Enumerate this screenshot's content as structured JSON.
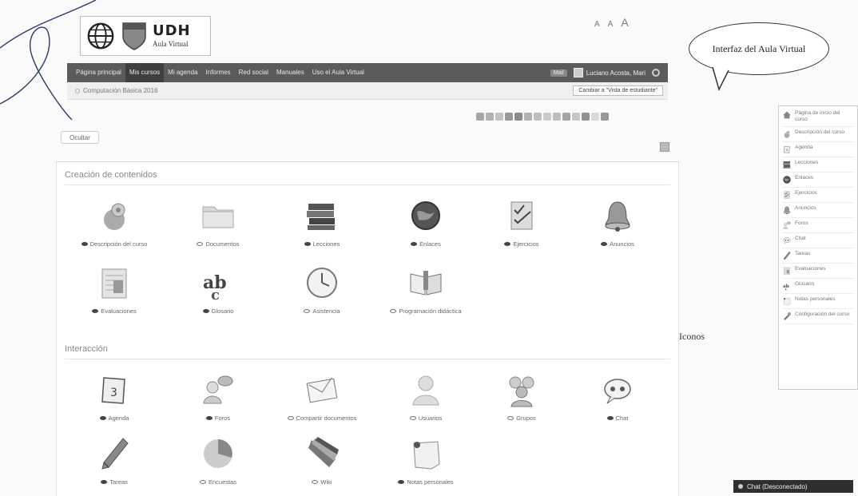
{
  "logo": {
    "name": "UDH",
    "subtitle": "Aula Virtual"
  },
  "font_tools": {
    "small": "A",
    "medium": "A",
    "large": "A"
  },
  "callout": {
    "text": "Interfaz del Aula Virtual"
  },
  "nav": {
    "items": [
      "Página principal",
      "Mis cursos",
      "Mi agenda",
      "Informes",
      "Red social",
      "Manuales",
      "Uso el Aula Virtual"
    ],
    "active_index": 1,
    "badge": "Mail",
    "user": "Luciano Acosta, Mari"
  },
  "breadcrumb": {
    "course": "Computación Básica 2016",
    "student_view": "Cambiar a \"Vista de estudiante\""
  },
  "hide_button": "Ocultar",
  "sections": {
    "creation": {
      "title": "Creación de contenidos",
      "tools": [
        {
          "label": "Descripción del curso",
          "icon": "gear-sphere-icon",
          "visible": true
        },
        {
          "label": "Documentos",
          "icon": "folder-icon",
          "visible": false
        },
        {
          "label": "Lecciones",
          "icon": "books-icon",
          "visible": true
        },
        {
          "label": "Enlaces",
          "icon": "globe-icon",
          "visible": true
        },
        {
          "label": "Ejercicios",
          "icon": "checklist-icon",
          "visible": true
        },
        {
          "label": "Anuncios",
          "icon": "bell-icon",
          "visible": true
        },
        {
          "label": "Evaluaciones",
          "icon": "gradebook-icon",
          "visible": true
        },
        {
          "label": "Glosario",
          "icon": "abc-icon",
          "visible": true
        },
        {
          "label": "Asistencia",
          "icon": "clock-icon",
          "visible": false
        },
        {
          "label": "Programación didáctica",
          "icon": "open-book-icon",
          "visible": false
        }
      ]
    },
    "interaction": {
      "title": "Interacción",
      "tools": [
        {
          "label": "Agenda",
          "icon": "calendar-icon",
          "visible": true
        },
        {
          "label": "Foros",
          "icon": "forum-icon",
          "visible": true
        },
        {
          "label": "Compartir documentos",
          "icon": "envelope-icon",
          "visible": false
        },
        {
          "label": "Usuarios",
          "icon": "user-icon",
          "visible": false
        },
        {
          "label": "Grupos",
          "icon": "group-icon",
          "visible": false
        },
        {
          "label": "Chat",
          "icon": "chat-icon",
          "visible": true
        },
        {
          "label": "Tareas",
          "icon": "pen-icon",
          "visible": true
        },
        {
          "label": "Encuestas",
          "icon": "pie-icon",
          "visible": false
        },
        {
          "label": "Wiki",
          "icon": "wiki-icon",
          "visible": false
        },
        {
          "label": "Notas personales",
          "icon": "note-icon",
          "visible": true
        }
      ]
    }
  },
  "iconos_label": "Iconos",
  "sidebar": {
    "items": [
      {
        "label": "Página de inicio del curso",
        "icon": "home-icon",
        "color": "#8a8a8a"
      },
      {
        "label": "Descripción del curso",
        "icon": "gear-sphere-icon",
        "color": "#9a9a9a"
      },
      {
        "label": "Agenda",
        "icon": "calendar-icon",
        "color": "#b0b0b0"
      },
      {
        "label": "Lecciones",
        "icon": "books-icon",
        "color": "#777777"
      },
      {
        "label": "Enlaces",
        "icon": "globe-icon",
        "color": "#666666"
      },
      {
        "label": "Ejercicios",
        "icon": "checklist-icon",
        "color": "#999999"
      },
      {
        "label": "Anuncios",
        "icon": "bell-icon",
        "color": "#aaaaaa"
      },
      {
        "label": "Foros",
        "icon": "forum-icon",
        "color": "#bbbbbb"
      },
      {
        "label": "Chat",
        "icon": "chat-icon",
        "color": "#aaaaaa"
      },
      {
        "label": "Tareas",
        "icon": "pen-icon",
        "color": "#888888"
      },
      {
        "label": "Evaluaciones",
        "icon": "gradebook-icon",
        "color": "#b5b5b5"
      },
      {
        "label": "Glosario",
        "icon": "abc-icon",
        "color": "#6f6f6f"
      },
      {
        "label": "Notas personales",
        "icon": "note-icon",
        "color": "#cfcfcf"
      },
      {
        "label": "Configuración del curso",
        "icon": "wrench-icon",
        "color": "#777777"
      }
    ]
  },
  "chat_bar": {
    "text": "Chat (Desconectado)"
  }
}
